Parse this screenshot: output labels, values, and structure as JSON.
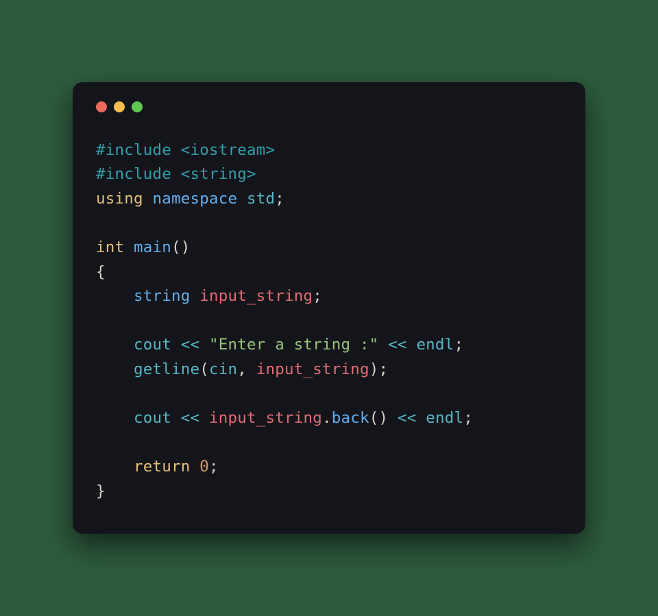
{
  "window": {
    "dot_red": "#ed6a5e",
    "dot_yellow": "#f4bf4f",
    "dot_green": "#61c554"
  },
  "colors": {
    "pre": "#309fab",
    "kw": "#e5c07b",
    "type": "#61afef",
    "ident": "#56b6c2",
    "func": "#61afef",
    "var": "#e06c75",
    "op": "#56b6c2",
    "str": "#98c379",
    "num": "#d19a66",
    "punc": "#d8d4c8"
  },
  "code": {
    "inc1": "#include <iostream>",
    "inc2": "#include <string>",
    "using": "using",
    "namespace": "namespace",
    "std": "std",
    "semi": ";",
    "int": "int",
    "main": "main",
    "lparen": "(",
    "rparen": ")",
    "lbrace": "{",
    "rbrace": "}",
    "indent": "    ",
    "string_t": "string",
    "var": "input_string",
    "cout": "cout",
    "ins": "<<",
    "prompt": "\"Enter a string :\"",
    "endl": "endl",
    "getline": "getline",
    "cin": "cin",
    "comma": ",",
    "dot": ".",
    "back": "back",
    "return": "return",
    "zero": "0",
    "sp": " "
  }
}
